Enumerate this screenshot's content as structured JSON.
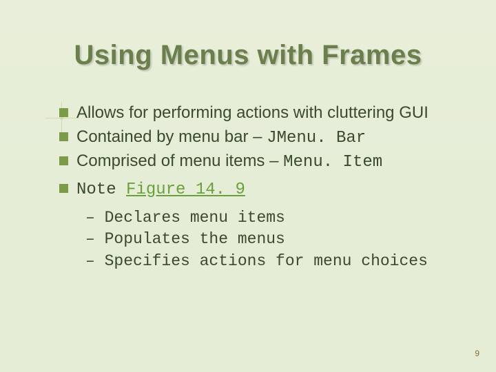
{
  "title": "Using Menus with Frames",
  "bullets": [
    {
      "pre": "Allows for performing actions with cluttering GUI",
      "mono": ""
    },
    {
      "pre": "Contained by menu bar – ",
      "mono": "JMenu. Bar"
    },
    {
      "pre": "Comprised of menu items – ",
      "mono": "Menu. Item"
    }
  ],
  "note": {
    "pre": "Note ",
    "link": "Figure 14. 9"
  },
  "subitems": [
    "Declares menu items",
    "Populates the menus",
    "Specifies actions for menu choices"
  ],
  "page_number": "9"
}
